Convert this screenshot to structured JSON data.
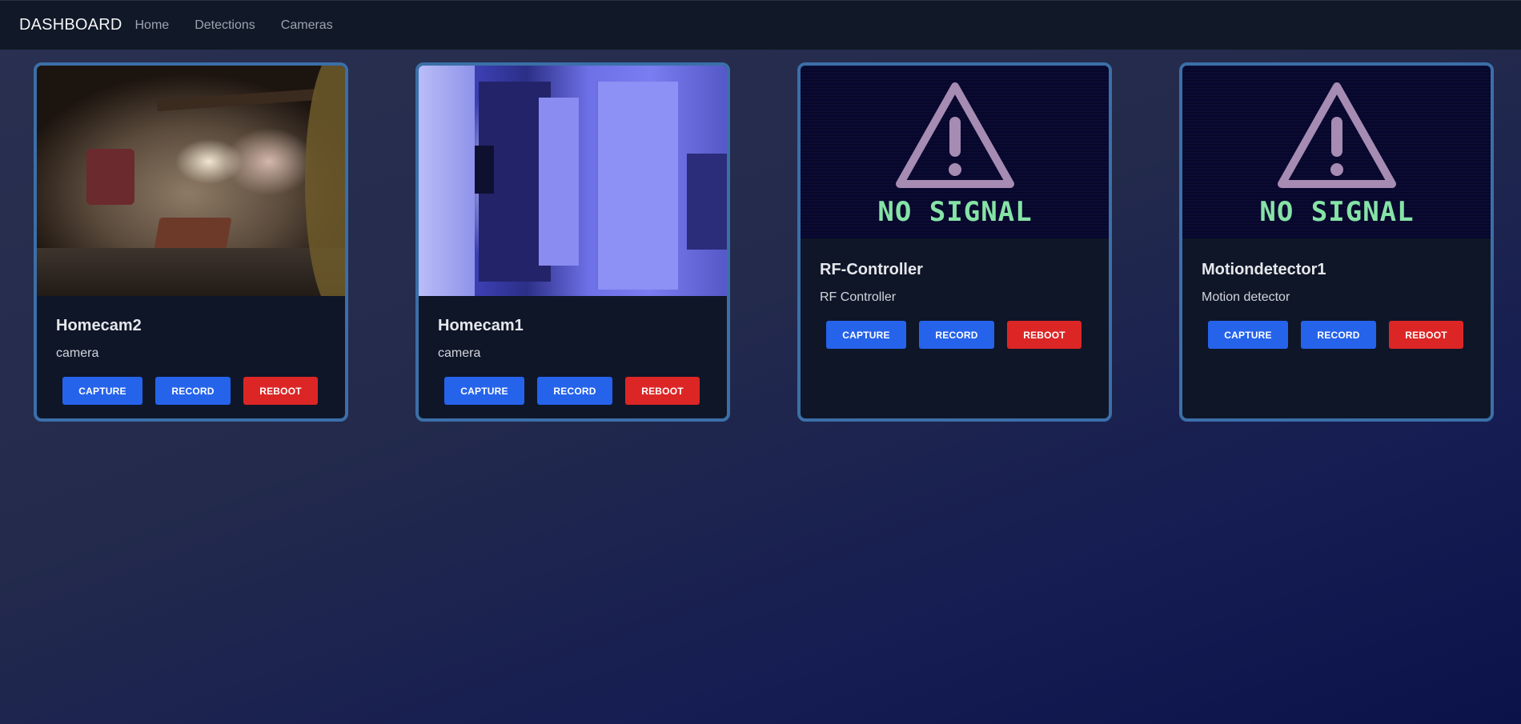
{
  "nav": {
    "brand": "DASHBOARD",
    "links": [
      "Home",
      "Detections",
      "Cameras"
    ]
  },
  "cards": [
    {
      "title": "Homecam2",
      "subtitle": "camera",
      "feed": "live",
      "buttons": {
        "capture": "CAPTURE",
        "record": "RECORD",
        "reboot": "REBOOT"
      }
    },
    {
      "title": "Homecam1",
      "subtitle": "camera",
      "feed": "live",
      "buttons": {
        "capture": "CAPTURE",
        "record": "RECORD",
        "reboot": "REBOOT"
      }
    },
    {
      "title": "RF-Controller",
      "subtitle": "RF Controller",
      "feed": "no-signal",
      "no_signal_text": "NO SIGNAL",
      "buttons": {
        "capture": "CAPTURE",
        "record": "RECORD",
        "reboot": "REBOOT"
      }
    },
    {
      "title": "Motiondetector1",
      "subtitle": "Motion detector",
      "feed": "no-signal",
      "no_signal_text": "NO SIGNAL",
      "buttons": {
        "capture": "CAPTURE",
        "record": "RECORD",
        "reboot": "REBOOT"
      }
    }
  ],
  "colors": {
    "primary_button": "#2563eb",
    "danger_button": "#dc2626",
    "card_border": "#3b6fa8",
    "navbar": "#111827",
    "no_signal_text": "#86e3a6",
    "warning_icon": "#a68bb3"
  },
  "icons": [
    "warning-triangle-icon"
  ]
}
